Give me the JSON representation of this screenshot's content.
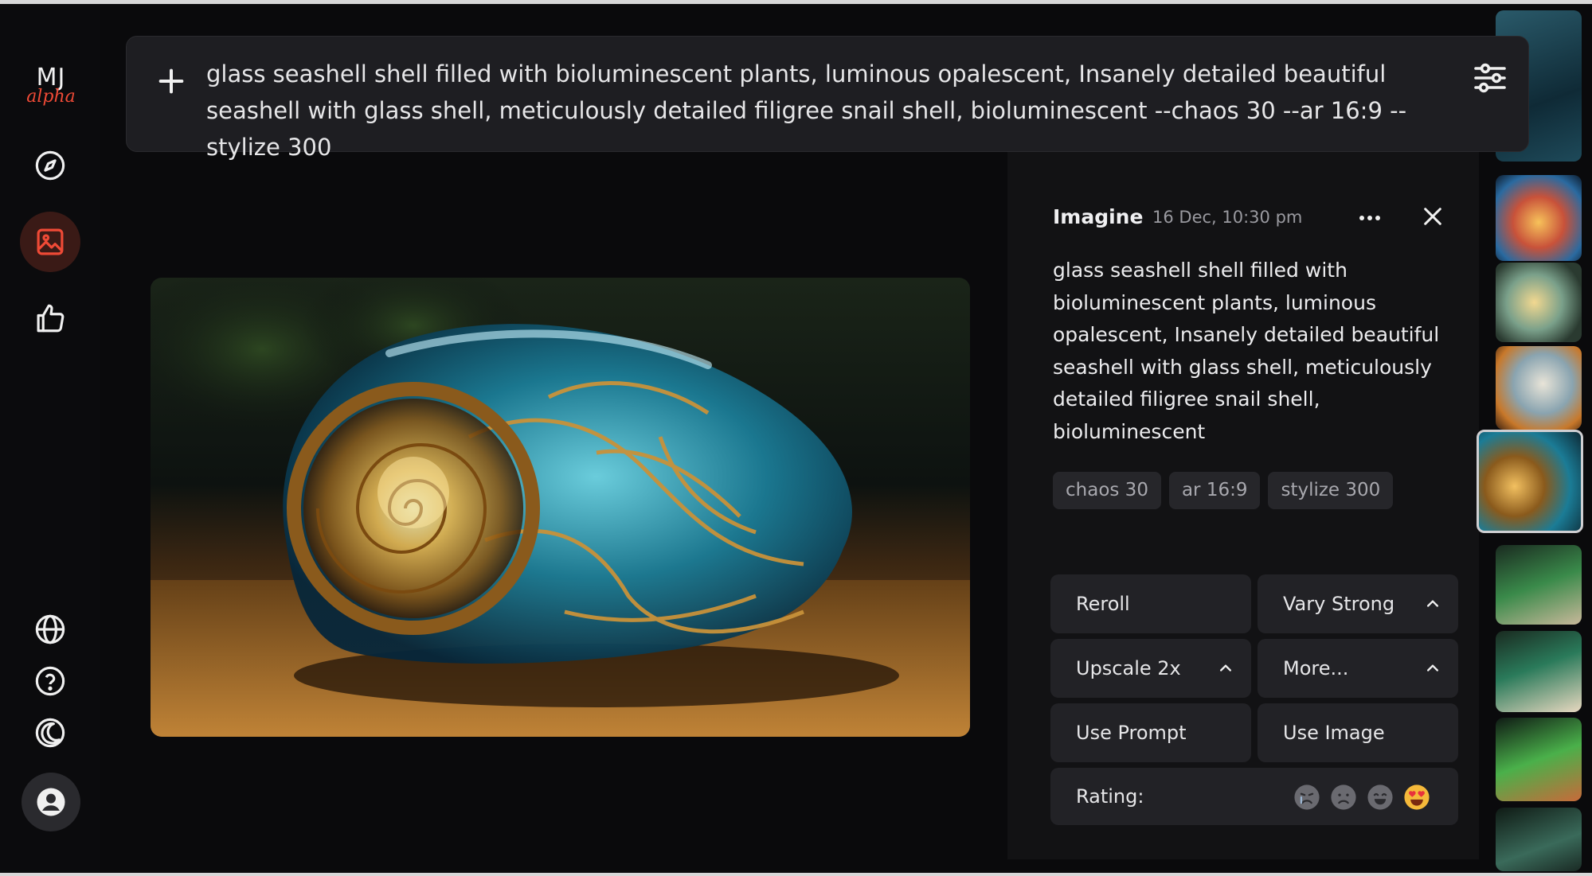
{
  "app": {
    "logo_text": "MJ",
    "logo_subtext": "alpha"
  },
  "sidebar": {
    "items": [
      {
        "name": "explore",
        "icon": "compass-icon"
      },
      {
        "name": "create",
        "icon": "image-icon",
        "active": true
      },
      {
        "name": "rank",
        "icon": "thumbs-up-icon"
      }
    ],
    "bottom_items": [
      {
        "name": "globe",
        "icon": "globe-icon"
      },
      {
        "name": "help",
        "icon": "help-circle-icon"
      },
      {
        "name": "theme",
        "icon": "moon-icon"
      },
      {
        "name": "account",
        "icon": "user-avatar-icon"
      }
    ]
  },
  "prompt_bar": {
    "text": "glass seashell shell filled with bioluminescent plants, luminous opalescent, Insanely detailed beautiful seashell with glass shell, meticulously detailed filigree snail shell, bioluminescent --chaos 30 --ar 16:9 --stylize 300"
  },
  "detail": {
    "title": "Imagine",
    "date": "16 Dec, 10:30 pm",
    "description": "glass seashell shell filled with bioluminescent plants, luminous opalescent, Insanely detailed beautiful seashell with glass shell, meticulously detailed filigree snail shell, bioluminescent",
    "tags": [
      "chaos 30",
      "ar 16:9",
      "stylize 300"
    ],
    "actions": {
      "reroll": "Reroll",
      "vary_strong": "Vary Strong",
      "upscale": "Upscale 2x",
      "more": "More...",
      "use_prompt": "Use Prompt",
      "use_image": "Use Image"
    },
    "rating_label": "Rating:"
  },
  "colors": {
    "accent": "#ef4a36",
    "background": "#0a0a0c",
    "panel": "#121214",
    "button": "#222226"
  }
}
